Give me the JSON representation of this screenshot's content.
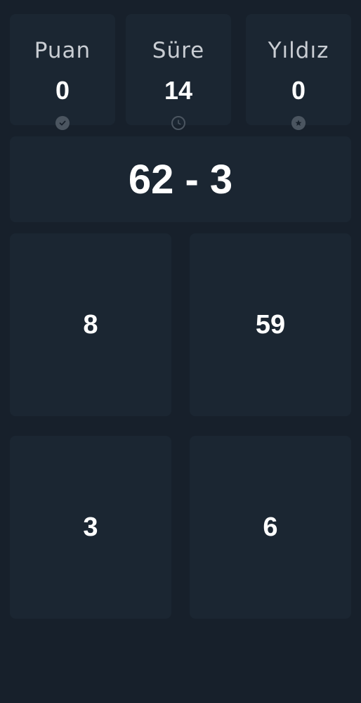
{
  "stats": [
    {
      "label": "Puan",
      "value": "0",
      "icon": "check-icon"
    },
    {
      "label": "Süre",
      "value": "14",
      "icon": "clock-icon"
    },
    {
      "label": "Yıldız",
      "value": "0",
      "icon": "star-icon"
    }
  ],
  "question": {
    "text": "62 - 3"
  },
  "answers": [
    {
      "value": "8"
    },
    {
      "value": "59"
    },
    {
      "value": "3"
    },
    {
      "value": "6"
    }
  ],
  "colors": {
    "background": "#17202b",
    "card": "#1b2632",
    "label": "#c9cdd3",
    "icon": "#4b5560"
  }
}
